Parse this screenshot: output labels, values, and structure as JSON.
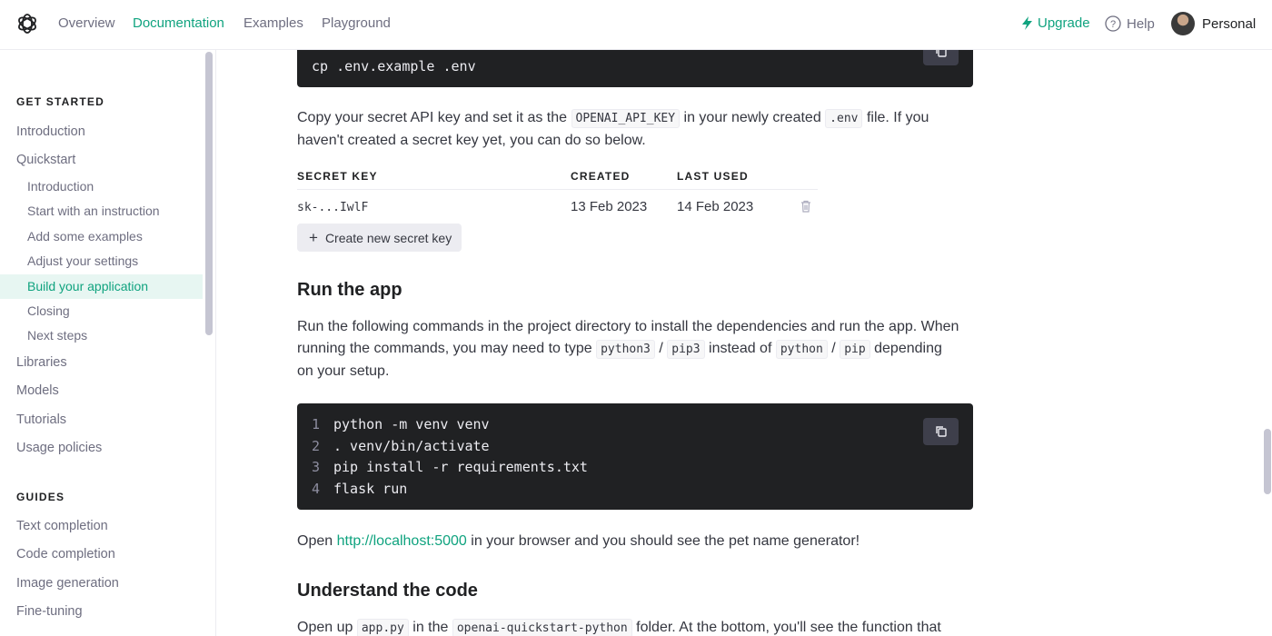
{
  "nav": {
    "overview": "Overview",
    "documentation": "Documentation",
    "examples": "Examples",
    "playground": "Playground",
    "upgrade": "Upgrade",
    "help": "Help",
    "personal": "Personal"
  },
  "sidebar": {
    "get_started_heading": "GET STARTED",
    "introduction": "Introduction",
    "quickstart": "Quickstart",
    "sub_items": [
      {
        "label": "Introduction",
        "active": false
      },
      {
        "label": "Start with an instruction",
        "active": false
      },
      {
        "label": "Add some examples",
        "active": false
      },
      {
        "label": "Adjust your settings",
        "active": false
      },
      {
        "label": "Build your application",
        "active": true
      },
      {
        "label": "Closing",
        "active": false
      },
      {
        "label": "Next steps",
        "active": false
      }
    ],
    "libraries": "Libraries",
    "models": "Models",
    "tutorials": "Tutorials",
    "usage_policies": "Usage policies",
    "guides_heading": "GUIDES",
    "guides": [
      "Text completion",
      "Code completion",
      "Image generation",
      "Fine-tuning"
    ]
  },
  "content": {
    "top_code_line": "cp .env.example .env",
    "para1_a": "Copy your secret API key and set it as the",
    "para1_code1": "OPENAI_API_KEY",
    "para1_b": "in your newly created",
    "para1_code2": ".env",
    "para1_c": "file. If you",
    "para1_line2": "haven't created a secret key yet, you can do so below.",
    "table": {
      "headers": [
        "SECRET KEY",
        "CREATED",
        "LAST USED"
      ],
      "row": {
        "key": "sk-...IwlF",
        "created": "13 Feb 2023",
        "last_used": "14 Feb 2023"
      }
    },
    "create_key_button": "Create new secret key",
    "run_heading": "Run the app",
    "run_para_line1": "Run the following commands in the project directory to install the dependencies and run the app. When",
    "run_para_a": "running the commands, you may need to type",
    "run_code_python3": "python3",
    "run_code_pip3": "pip3",
    "run_para_b": "instead of",
    "run_code_python": "python",
    "run_code_pip": "pip",
    "run_para_c": "depending",
    "run_para_line3": "on your setup.",
    "slash": "/",
    "code_lines": [
      {
        "n": "1",
        "text": "python -m venv venv"
      },
      {
        "n": "2",
        "text": ". venv/bin/activate"
      },
      {
        "n": "3",
        "text": "pip install -r requirements.txt"
      },
      {
        "n": "4",
        "text": "flask run"
      }
    ],
    "open_a": "Open",
    "open_link": "http://localhost:5000",
    "open_b": "in your browser and you should see the pet name generator!",
    "understand_heading": "Understand the code",
    "bottom_a": "Open up",
    "bottom_code1": "app.py",
    "bottom_b": "in the",
    "bottom_code2": "openai-quickstart-python",
    "bottom_c": "folder. At the bottom, you'll see the function that"
  },
  "colors": {
    "accent": "#10a37f",
    "code_bg": "#202123",
    "active_bg": "#e7f6f2"
  }
}
